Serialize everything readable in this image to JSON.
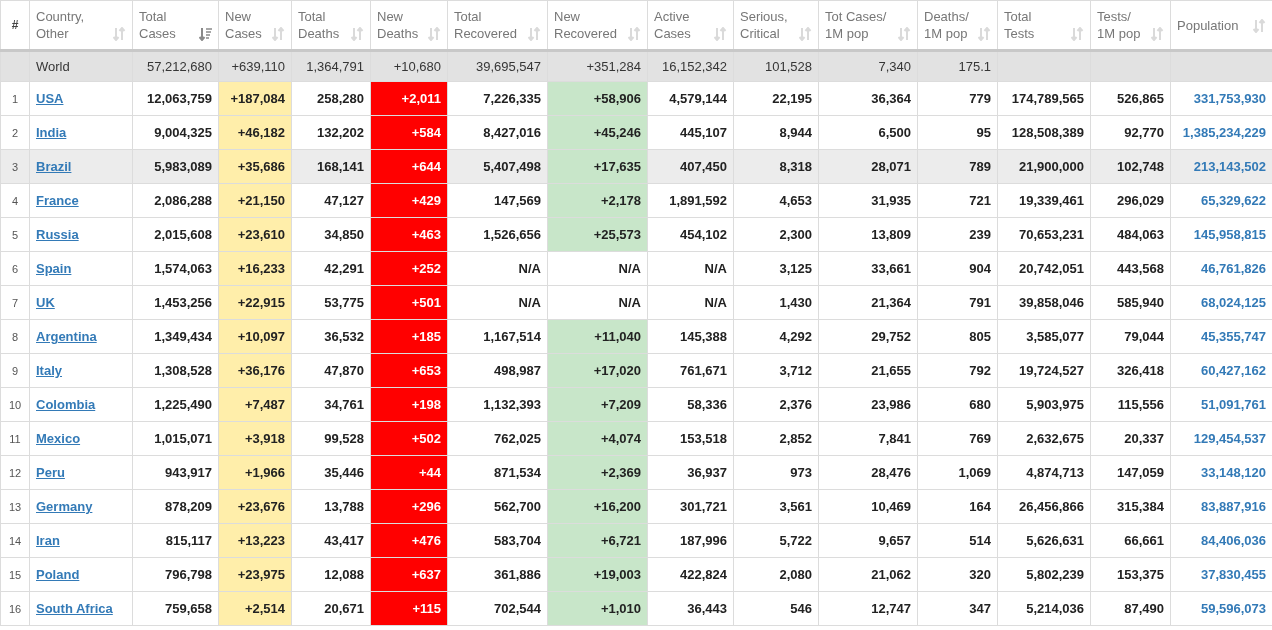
{
  "table": {
    "columns": [
      {
        "label": "#",
        "kind": "index"
      },
      {
        "label": "Country,\nOther",
        "kind": "name",
        "sorted": false
      },
      {
        "label": "Total\nCases",
        "kind": "number",
        "sorted": true
      },
      {
        "label": "New\nCases",
        "kind": "new_cases",
        "sorted": false
      },
      {
        "label": "Total\nDeaths",
        "kind": "number",
        "sorted": false
      },
      {
        "label": "New\nDeaths",
        "kind": "new_deaths",
        "sorted": false
      },
      {
        "label": "Total\nRecovered",
        "kind": "number",
        "sorted": false
      },
      {
        "label": "New\nRecovered",
        "kind": "new_recovered",
        "sorted": false
      },
      {
        "label": "Active\nCases",
        "kind": "number",
        "sorted": false
      },
      {
        "label": "Serious,\nCritical",
        "kind": "number",
        "sorted": false
      },
      {
        "label": "Tot Cases/\n1M pop",
        "kind": "number",
        "sorted": false
      },
      {
        "label": "Deaths/\n1M pop",
        "kind": "number",
        "sorted": false
      },
      {
        "label": "Total\nTests",
        "kind": "number",
        "sorted": false
      },
      {
        "label": "Tests/\n1M pop",
        "kind": "number",
        "sorted": false
      },
      {
        "label": "Population",
        "kind": "population",
        "sorted": false
      }
    ],
    "world": {
      "cells": [
        "",
        "World",
        "57,212,680",
        "+639,110",
        "1,364,791",
        "+10,680",
        "39,695,547",
        "+351,284",
        "16,152,342",
        "101,528",
        "7,340",
        "175.1",
        "",
        "",
        ""
      ]
    },
    "rows": [
      {
        "selected": false,
        "recovered_reported": true,
        "cells": [
          "1",
          "USA",
          "12,063,759",
          "+187,084",
          "258,280",
          "+2,011",
          "7,226,335",
          "+58,906",
          "4,579,144",
          "22,195",
          "36,364",
          "779",
          "174,789,565",
          "526,865",
          "331,753,930"
        ]
      },
      {
        "selected": false,
        "recovered_reported": true,
        "cells": [
          "2",
          "India",
          "9,004,325",
          "+46,182",
          "132,202",
          "+584",
          "8,427,016",
          "+45,246",
          "445,107",
          "8,944",
          "6,500",
          "95",
          "128,508,389",
          "92,770",
          "1,385,234,229"
        ]
      },
      {
        "selected": true,
        "recovered_reported": true,
        "cells": [
          "3",
          "Brazil",
          "5,983,089",
          "+35,686",
          "168,141",
          "+644",
          "5,407,498",
          "+17,635",
          "407,450",
          "8,318",
          "28,071",
          "789",
          "21,900,000",
          "102,748",
          "213,143,502"
        ]
      },
      {
        "selected": false,
        "recovered_reported": true,
        "cells": [
          "4",
          "France",
          "2,086,288",
          "+21,150",
          "47,127",
          "+429",
          "147,569",
          "+2,178",
          "1,891,592",
          "4,653",
          "31,935",
          "721",
          "19,339,461",
          "296,029",
          "65,329,622"
        ]
      },
      {
        "selected": false,
        "recovered_reported": true,
        "cells": [
          "5",
          "Russia",
          "2,015,608",
          "+23,610",
          "34,850",
          "+463",
          "1,526,656",
          "+25,573",
          "454,102",
          "2,300",
          "13,809",
          "239",
          "70,653,231",
          "484,063",
          "145,958,815"
        ]
      },
      {
        "selected": false,
        "recovered_reported": false,
        "cells": [
          "6",
          "Spain",
          "1,574,063",
          "+16,233",
          "42,291",
          "+252",
          "N/A",
          "N/A",
          "N/A",
          "3,125",
          "33,661",
          "904",
          "20,742,051",
          "443,568",
          "46,761,826"
        ]
      },
      {
        "selected": false,
        "recovered_reported": false,
        "cells": [
          "7",
          "UK",
          "1,453,256",
          "+22,915",
          "53,775",
          "+501",
          "N/A",
          "N/A",
          "N/A",
          "1,430",
          "21,364",
          "791",
          "39,858,046",
          "585,940",
          "68,024,125"
        ]
      },
      {
        "selected": false,
        "recovered_reported": true,
        "cells": [
          "8",
          "Argentina",
          "1,349,434",
          "+10,097",
          "36,532",
          "+185",
          "1,167,514",
          "+11,040",
          "145,388",
          "4,292",
          "29,752",
          "805",
          "3,585,077",
          "79,044",
          "45,355,747"
        ]
      },
      {
        "selected": false,
        "recovered_reported": true,
        "cells": [
          "9",
          "Italy",
          "1,308,528",
          "+36,176",
          "47,870",
          "+653",
          "498,987",
          "+17,020",
          "761,671",
          "3,712",
          "21,655",
          "792",
          "19,724,527",
          "326,418",
          "60,427,162"
        ]
      },
      {
        "selected": false,
        "recovered_reported": true,
        "cells": [
          "10",
          "Colombia",
          "1,225,490",
          "+7,487",
          "34,761",
          "+198",
          "1,132,393",
          "+7,209",
          "58,336",
          "2,376",
          "23,986",
          "680",
          "5,903,975",
          "115,556",
          "51,091,761"
        ]
      },
      {
        "selected": false,
        "recovered_reported": true,
        "cells": [
          "11",
          "Mexico",
          "1,015,071",
          "+3,918",
          "99,528",
          "+502",
          "762,025",
          "+4,074",
          "153,518",
          "2,852",
          "7,841",
          "769",
          "2,632,675",
          "20,337",
          "129,454,537"
        ]
      },
      {
        "selected": false,
        "recovered_reported": true,
        "cells": [
          "12",
          "Peru",
          "943,917",
          "+1,966",
          "35,446",
          "+44",
          "871,534",
          "+2,369",
          "36,937",
          "973",
          "28,476",
          "1,069",
          "4,874,713",
          "147,059",
          "33,148,120"
        ]
      },
      {
        "selected": false,
        "recovered_reported": true,
        "cells": [
          "13",
          "Germany",
          "878,209",
          "+23,676",
          "13,788",
          "+296",
          "562,700",
          "+16,200",
          "301,721",
          "3,561",
          "10,469",
          "164",
          "26,456,866",
          "315,384",
          "83,887,916"
        ]
      },
      {
        "selected": false,
        "recovered_reported": true,
        "cells": [
          "14",
          "Iran",
          "815,117",
          "+13,223",
          "43,417",
          "+476",
          "583,704",
          "+6,721",
          "187,996",
          "5,722",
          "9,657",
          "514",
          "5,626,631",
          "66,661",
          "84,406,036"
        ]
      },
      {
        "selected": false,
        "recovered_reported": true,
        "cells": [
          "15",
          "Poland",
          "796,798",
          "+23,975",
          "12,088",
          "+637",
          "361,886",
          "+19,003",
          "422,824",
          "2,080",
          "21,062",
          "320",
          "5,802,239",
          "153,375",
          "37,830,455"
        ]
      },
      {
        "selected": false,
        "recovered_reported": true,
        "cells": [
          "16",
          "South Africa",
          "759,658",
          "+2,514",
          "20,671",
          "+115",
          "702,544",
          "+1,010",
          "36,443",
          "546",
          "12,747",
          "347",
          "5,214,036",
          "87,490",
          "59,596,073"
        ]
      }
    ]
  }
}
